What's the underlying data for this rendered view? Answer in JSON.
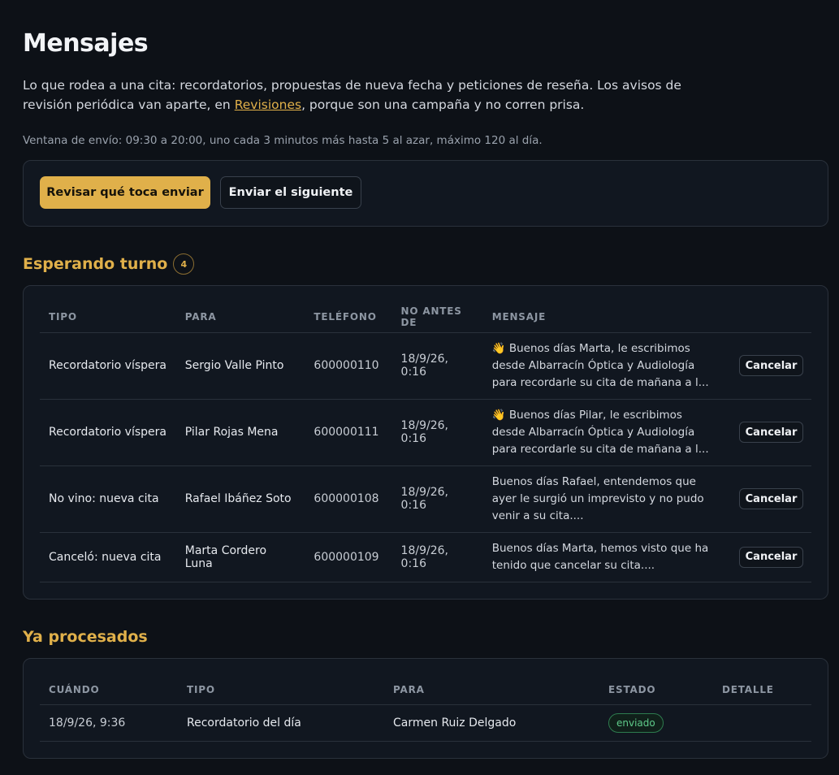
{
  "header": {
    "title": "Mensajes",
    "intro_before_link": "Lo que rodea a una cita: recordatorios, propuestas de nueva fecha y peticiones de reseña. Los avisos de revisión periódica van aparte, en ",
    "intro_link": "Revisiones",
    "intro_after_link": ", porque son una campaña y no corren prisa.",
    "send_window": "Ventana de envío: 09:30 a 20:00, uno cada 3 minutos más hasta 5 al azar, máximo 120 al día."
  },
  "actions": {
    "review_label": "Revisar qué toca enviar",
    "send_next_label": "Enviar el siguiente"
  },
  "queue": {
    "title": "Esperando turno",
    "count": "4",
    "columns": [
      "TIPO",
      "PARA",
      "TELÉFONO",
      "NO ANTES DE",
      "MENSAJE"
    ],
    "cancel_label": "Cancelar",
    "rows": [
      {
        "tipo": "Recordatorio víspera",
        "para": "Sergio Valle Pinto",
        "telefono": "600000110",
        "fecha": "18/9/26, 0:16",
        "mensaje": "👋 Buenos días Marta, le escribimos desde Albarracín Óptica y Audiología para recordarle su cita de mañana a l..."
      },
      {
        "tipo": "Recordatorio víspera",
        "para": "Pilar Rojas Mena",
        "telefono": "600000111",
        "fecha": "18/9/26, 0:16",
        "mensaje": "👋 Buenos días Pilar, le escribimos desde Albarracín Óptica y Audiología para recordarle su cita de mañana a l..."
      },
      {
        "tipo": "No vino: nueva cita",
        "para": "Rafael Ibáñez Soto",
        "telefono": "600000108",
        "fecha": "18/9/26, 0:16",
        "mensaje": "Buenos días Rafael, entendemos que ayer le surgió un imprevisto y no pudo venir a su cita...."
      },
      {
        "tipo": "Canceló: nueva cita",
        "para": "Marta Cordero Luna",
        "telefono": "600000109",
        "fecha": "18/9/26, 0:16",
        "mensaje": "Buenos días Marta, hemos visto que ha tenido que cancelar su cita...."
      }
    ]
  },
  "processed": {
    "title": "Ya procesados",
    "columns": [
      "CUÁNDO",
      "TIPO",
      "PARA",
      "ESTADO",
      "DETALLE"
    ],
    "rows": [
      {
        "cuando": "18/9/26, 9:36",
        "tipo": "Recordatorio del día",
        "para": "Carmen Ruiz Delgado",
        "estado": "enviado",
        "detalle": ""
      }
    ]
  },
  "colors": {
    "accent": "#e0b04a",
    "background": "#0d1117",
    "card": "#111720",
    "status_ok": "#5fcb8a"
  }
}
